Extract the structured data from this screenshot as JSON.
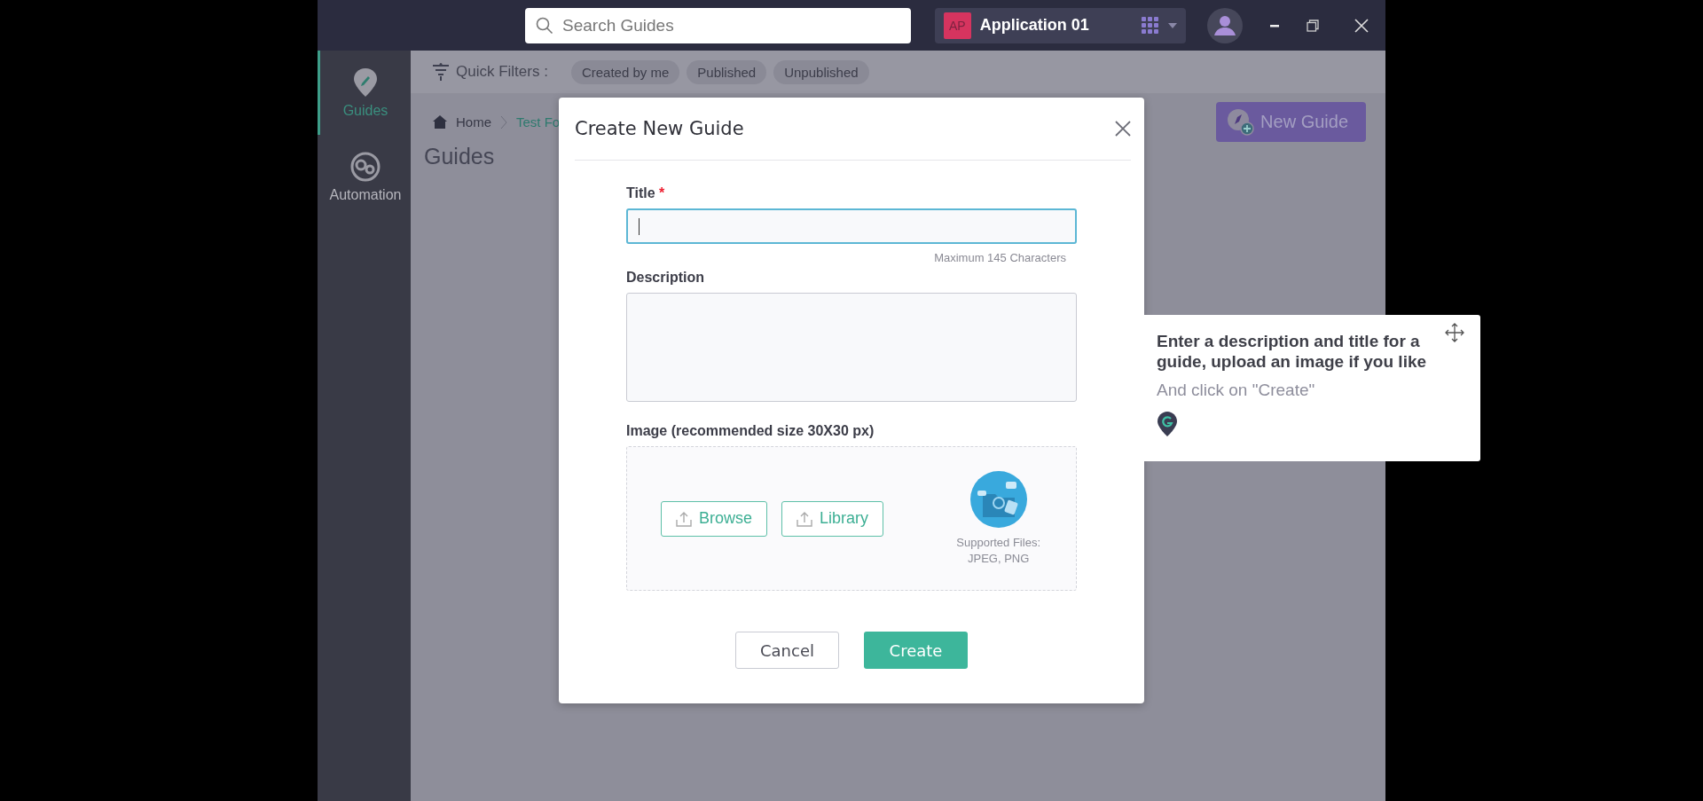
{
  "top_bar": {
    "search": {
      "placeholder": "Search Guides"
    },
    "app": {
      "badge": "AP",
      "name": "Application 01"
    }
  },
  "sidebar": {
    "items": [
      {
        "label": "Guides",
        "kind": "guides",
        "selected": true
      },
      {
        "label": "Automation",
        "kind": "automation",
        "selected": false
      }
    ]
  },
  "quick_filters": {
    "label": "Quick Filters :",
    "items": [
      "Created by me",
      "Published",
      "Unpublished"
    ]
  },
  "breadcrumb": [
    "Home",
    "Test Fo"
  ],
  "page_title": "Guides",
  "new_guide_button": "New Guide",
  "dialog": {
    "title": "Create New Guide",
    "title_field": {
      "label": "Title",
      "required_mark": "*",
      "focused": true,
      "hint": "Maximum 145 Characters"
    },
    "description_field": {
      "label": "Description"
    },
    "image": {
      "label": "Image (recommended size 30X30 px)",
      "buttons": [
        "Browse",
        "Library"
      ],
      "supported": [
        "Supported Files:",
        "JPEG, PNG"
      ]
    },
    "buttons": [
      {
        "label": "Cancel",
        "kind": "secondary"
      },
      {
        "label": "Create",
        "kind": "primary"
      }
    ]
  },
  "tooltip": {
    "heading": "Enter a description and title for a guide, upload an image if you like",
    "text": "And click on \"Create\""
  }
}
